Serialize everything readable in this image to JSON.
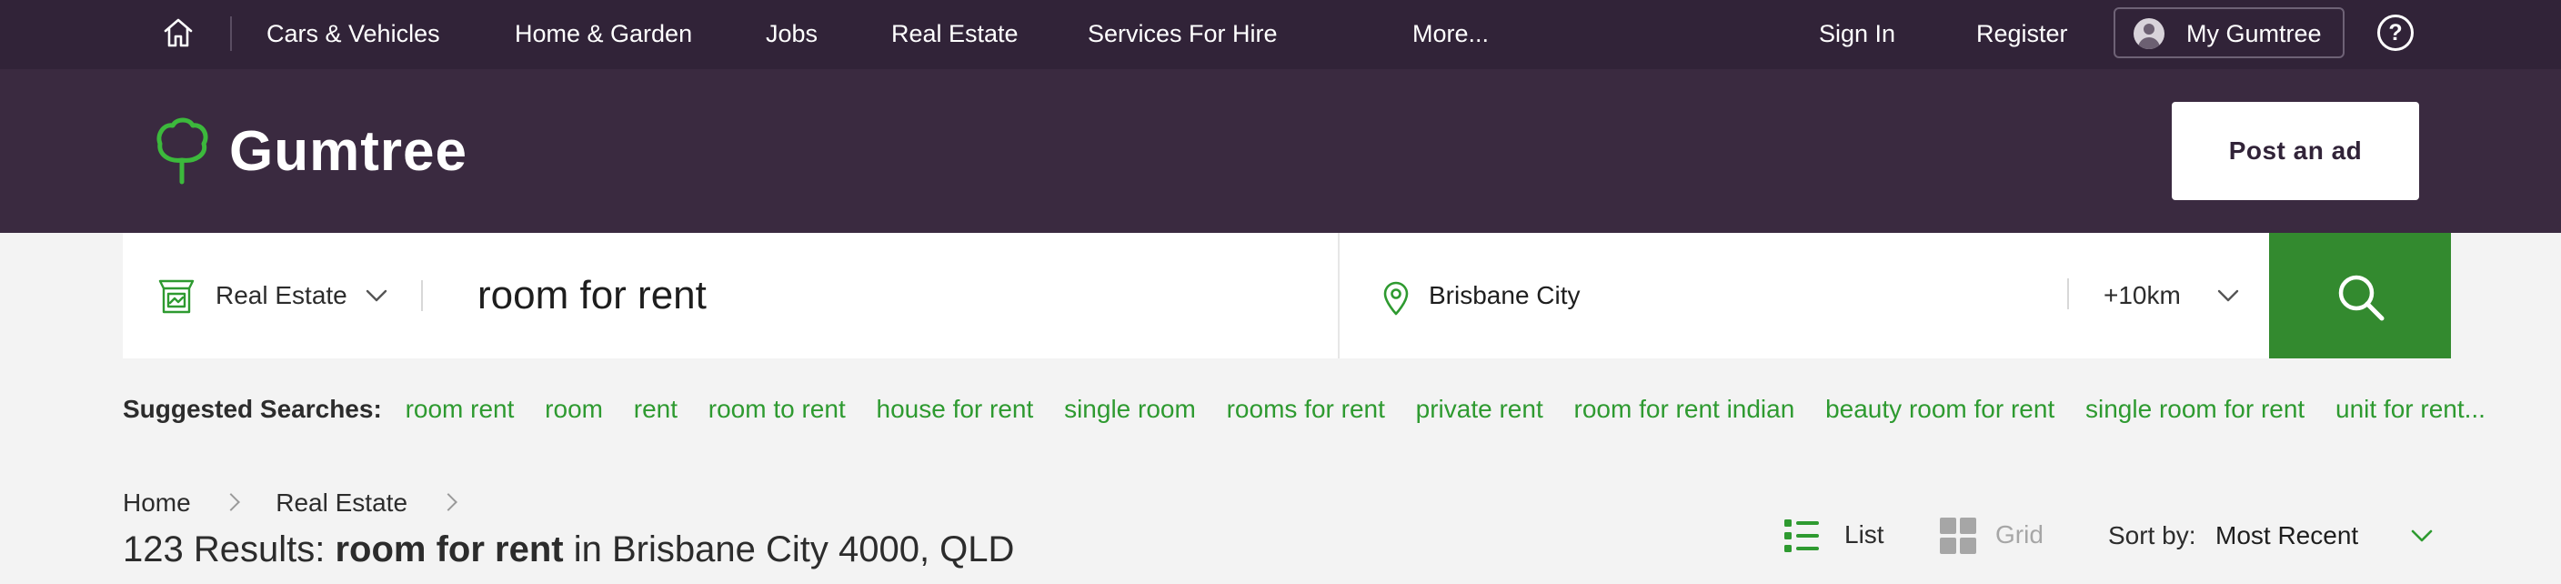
{
  "topnav": {
    "home_icon": "home-icon",
    "items": [
      "Cars & Vehicles",
      "Home & Garden",
      "Jobs",
      "Real Estate",
      "Services For Hire",
      "More..."
    ],
    "sign_in": "Sign In",
    "register": "Register",
    "my_gumtree": "My Gumtree",
    "help": "?"
  },
  "header": {
    "logo": "Gumtree",
    "post_ad": "Post an ad"
  },
  "search": {
    "category": "Real Estate",
    "query": "room for rent",
    "location": "Brisbane City",
    "radius": "+10km"
  },
  "suggested": {
    "title": "Suggested Searches:",
    "items": [
      "room rent",
      "room",
      "rent",
      "room to rent",
      "house for rent",
      "single room",
      "rooms for rent",
      "private rent",
      "room for rent indian",
      "beauty room for rent",
      "single room for rent",
      "unit for rent..."
    ]
  },
  "breadcrumb": [
    "Home",
    "Real Estate"
  ],
  "results": {
    "count": "123 Results:",
    "term": "room for rent",
    "in": "in",
    "location": "Brisbane City 4000, QLD"
  },
  "view": {
    "list": "List",
    "grid": "Grid"
  },
  "sort": {
    "label": "Sort by:",
    "value": "Most Recent"
  },
  "colors": {
    "nav_bg": "#312338",
    "header_bg": "#3a2a40",
    "accent_green": "#338a2f",
    "link_green": "#2e9a30"
  }
}
